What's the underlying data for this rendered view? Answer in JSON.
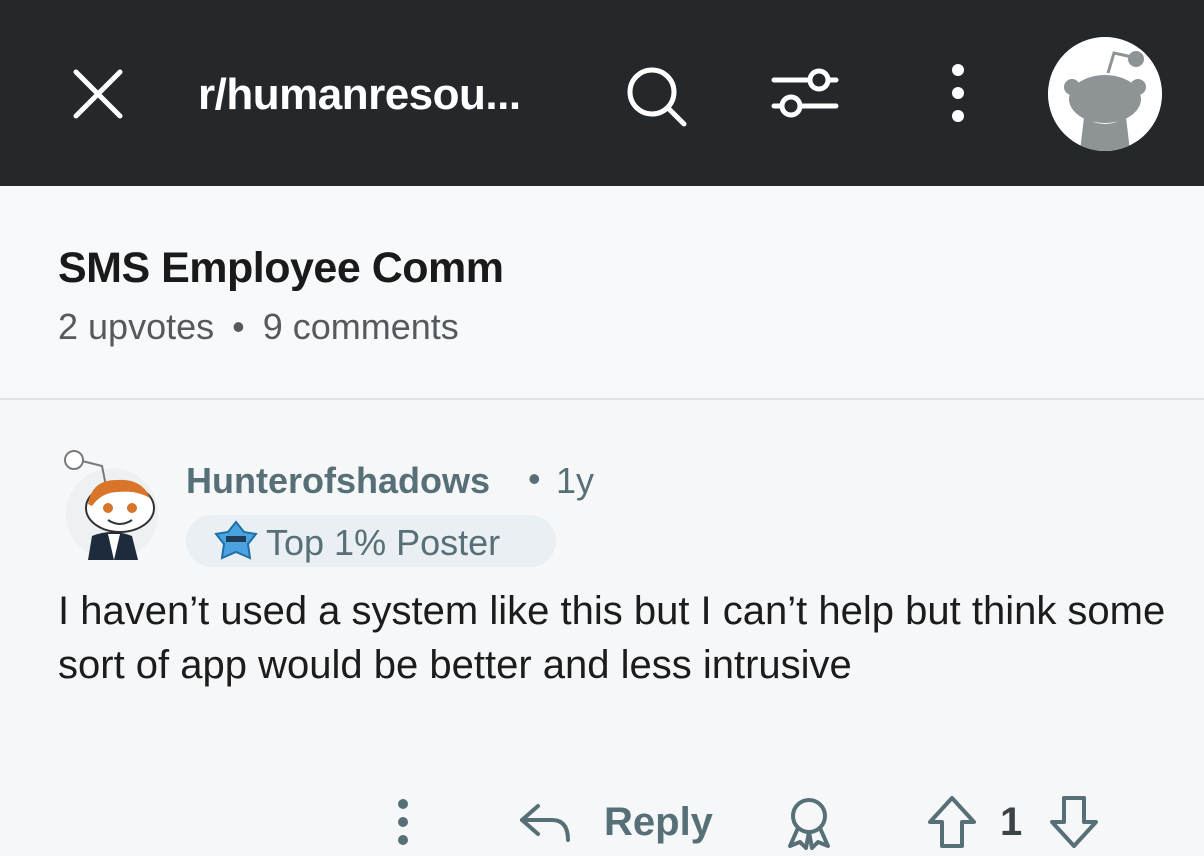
{
  "header": {
    "subreddit": "r/humanresou...",
    "icons": [
      "close-icon",
      "search-icon",
      "filter-icon",
      "more-vertical-icon",
      "avatar"
    ]
  },
  "post": {
    "title": "SMS Employee Comm",
    "upvotes": "2 upvotes",
    "separator": "•",
    "comments": "9 comments"
  },
  "comment": {
    "username": "Hunterofshadows",
    "separator": "•",
    "age": "1y",
    "flair": "Top 1% Poster",
    "body": "I haven’t used a system like this but I can’t help but think some sort of app would be better and less intrusive",
    "actions": {
      "reply_label": "Reply",
      "score": "1"
    }
  },
  "colors": {
    "topbar": "#25282b",
    "meta_text": "#576f76",
    "background": "#f6f7f8"
  }
}
